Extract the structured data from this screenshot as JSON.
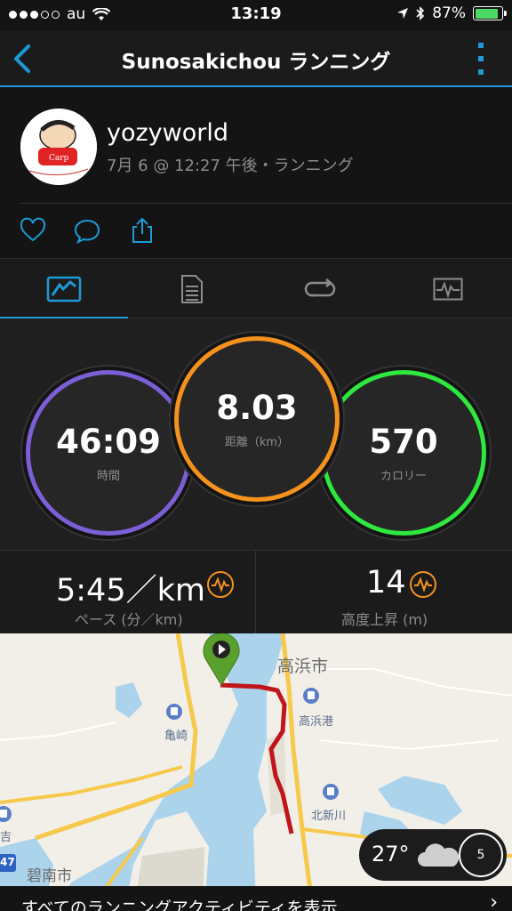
{
  "status_bar": {
    "carrier": "au",
    "time": "13:19",
    "battery": "87%",
    "battery_level": 0.87
  },
  "header": {
    "title": "Sunosakichou ランニング"
  },
  "activity": {
    "user": "yozyworld",
    "meta": "7月 6 @ 12:27 午後・ランニング"
  },
  "tabs": [
    {
      "name": "overview",
      "active": true
    },
    {
      "name": "details",
      "active": false
    },
    {
      "name": "laps",
      "active": false
    },
    {
      "name": "charts",
      "active": false
    }
  ],
  "stats": {
    "time": {
      "value": "46:09",
      "label": "時間",
      "color": "#7b5fd6"
    },
    "distance": {
      "value": "8.03",
      "label": "距離（km）",
      "color": "#f5921e"
    },
    "calories": {
      "value": "570",
      "label": "カロリー",
      "color": "#2ee83e"
    }
  },
  "metrics": {
    "pace": {
      "value": "5:45／km",
      "label": "ペース (分／km)"
    },
    "elevation": {
      "value": "14",
      "label": "高度上昇 (m)"
    }
  },
  "map": {
    "city": "高浜市",
    "place_kamezaki": "亀崎",
    "station_takahama": "高浜港",
    "station_kitashinkawa": "北新川",
    "label_left": "吉",
    "label_bottom": "碧南市",
    "route_number": "47",
    "weather_temp": "27°",
    "wind": "5"
  },
  "footer": {
    "link": "すべてのランニングアクティビティを表示"
  },
  "colors": {
    "accent": "#1d9bd7",
    "route": "#c0161b",
    "start_marker": "#5aa02c"
  }
}
